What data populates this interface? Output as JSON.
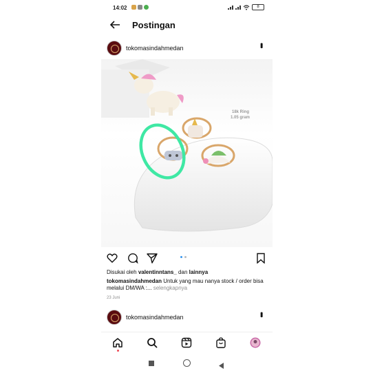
{
  "status_bar": {
    "time": "14:02",
    "battery": "8"
  },
  "app_bar": {
    "title": "Postingan"
  },
  "post": {
    "username": "tokomasindahmedan",
    "photo_text": {
      "line1": "18k Ring",
      "line2": "1.05 gram"
    },
    "likes": {
      "prefix": "Disukai oleh ",
      "user": "valentinntans_",
      "middle": " dan ",
      "suffix": "lainnya"
    },
    "caption": {
      "user": "tokomasindahmedan",
      "text": " Untuk yang mau nanya stock / order bisa melalui DM/WA :...",
      "more": " selengkapnya"
    },
    "date": "23 Juni"
  },
  "next_post": {
    "username": "tokomasindahmedan"
  },
  "colors": {
    "highlight": "#3fe8a4",
    "like_dot": "#3897f0",
    "notif_dot": "#ed4956"
  },
  "icons": [
    "back-arrow-icon",
    "more-options-icon",
    "heart-icon",
    "comment-icon",
    "share-icon",
    "bookmark-icon",
    "home-icon",
    "search-icon",
    "reels-icon",
    "shop-icon",
    "profile-avatar-icon"
  ]
}
